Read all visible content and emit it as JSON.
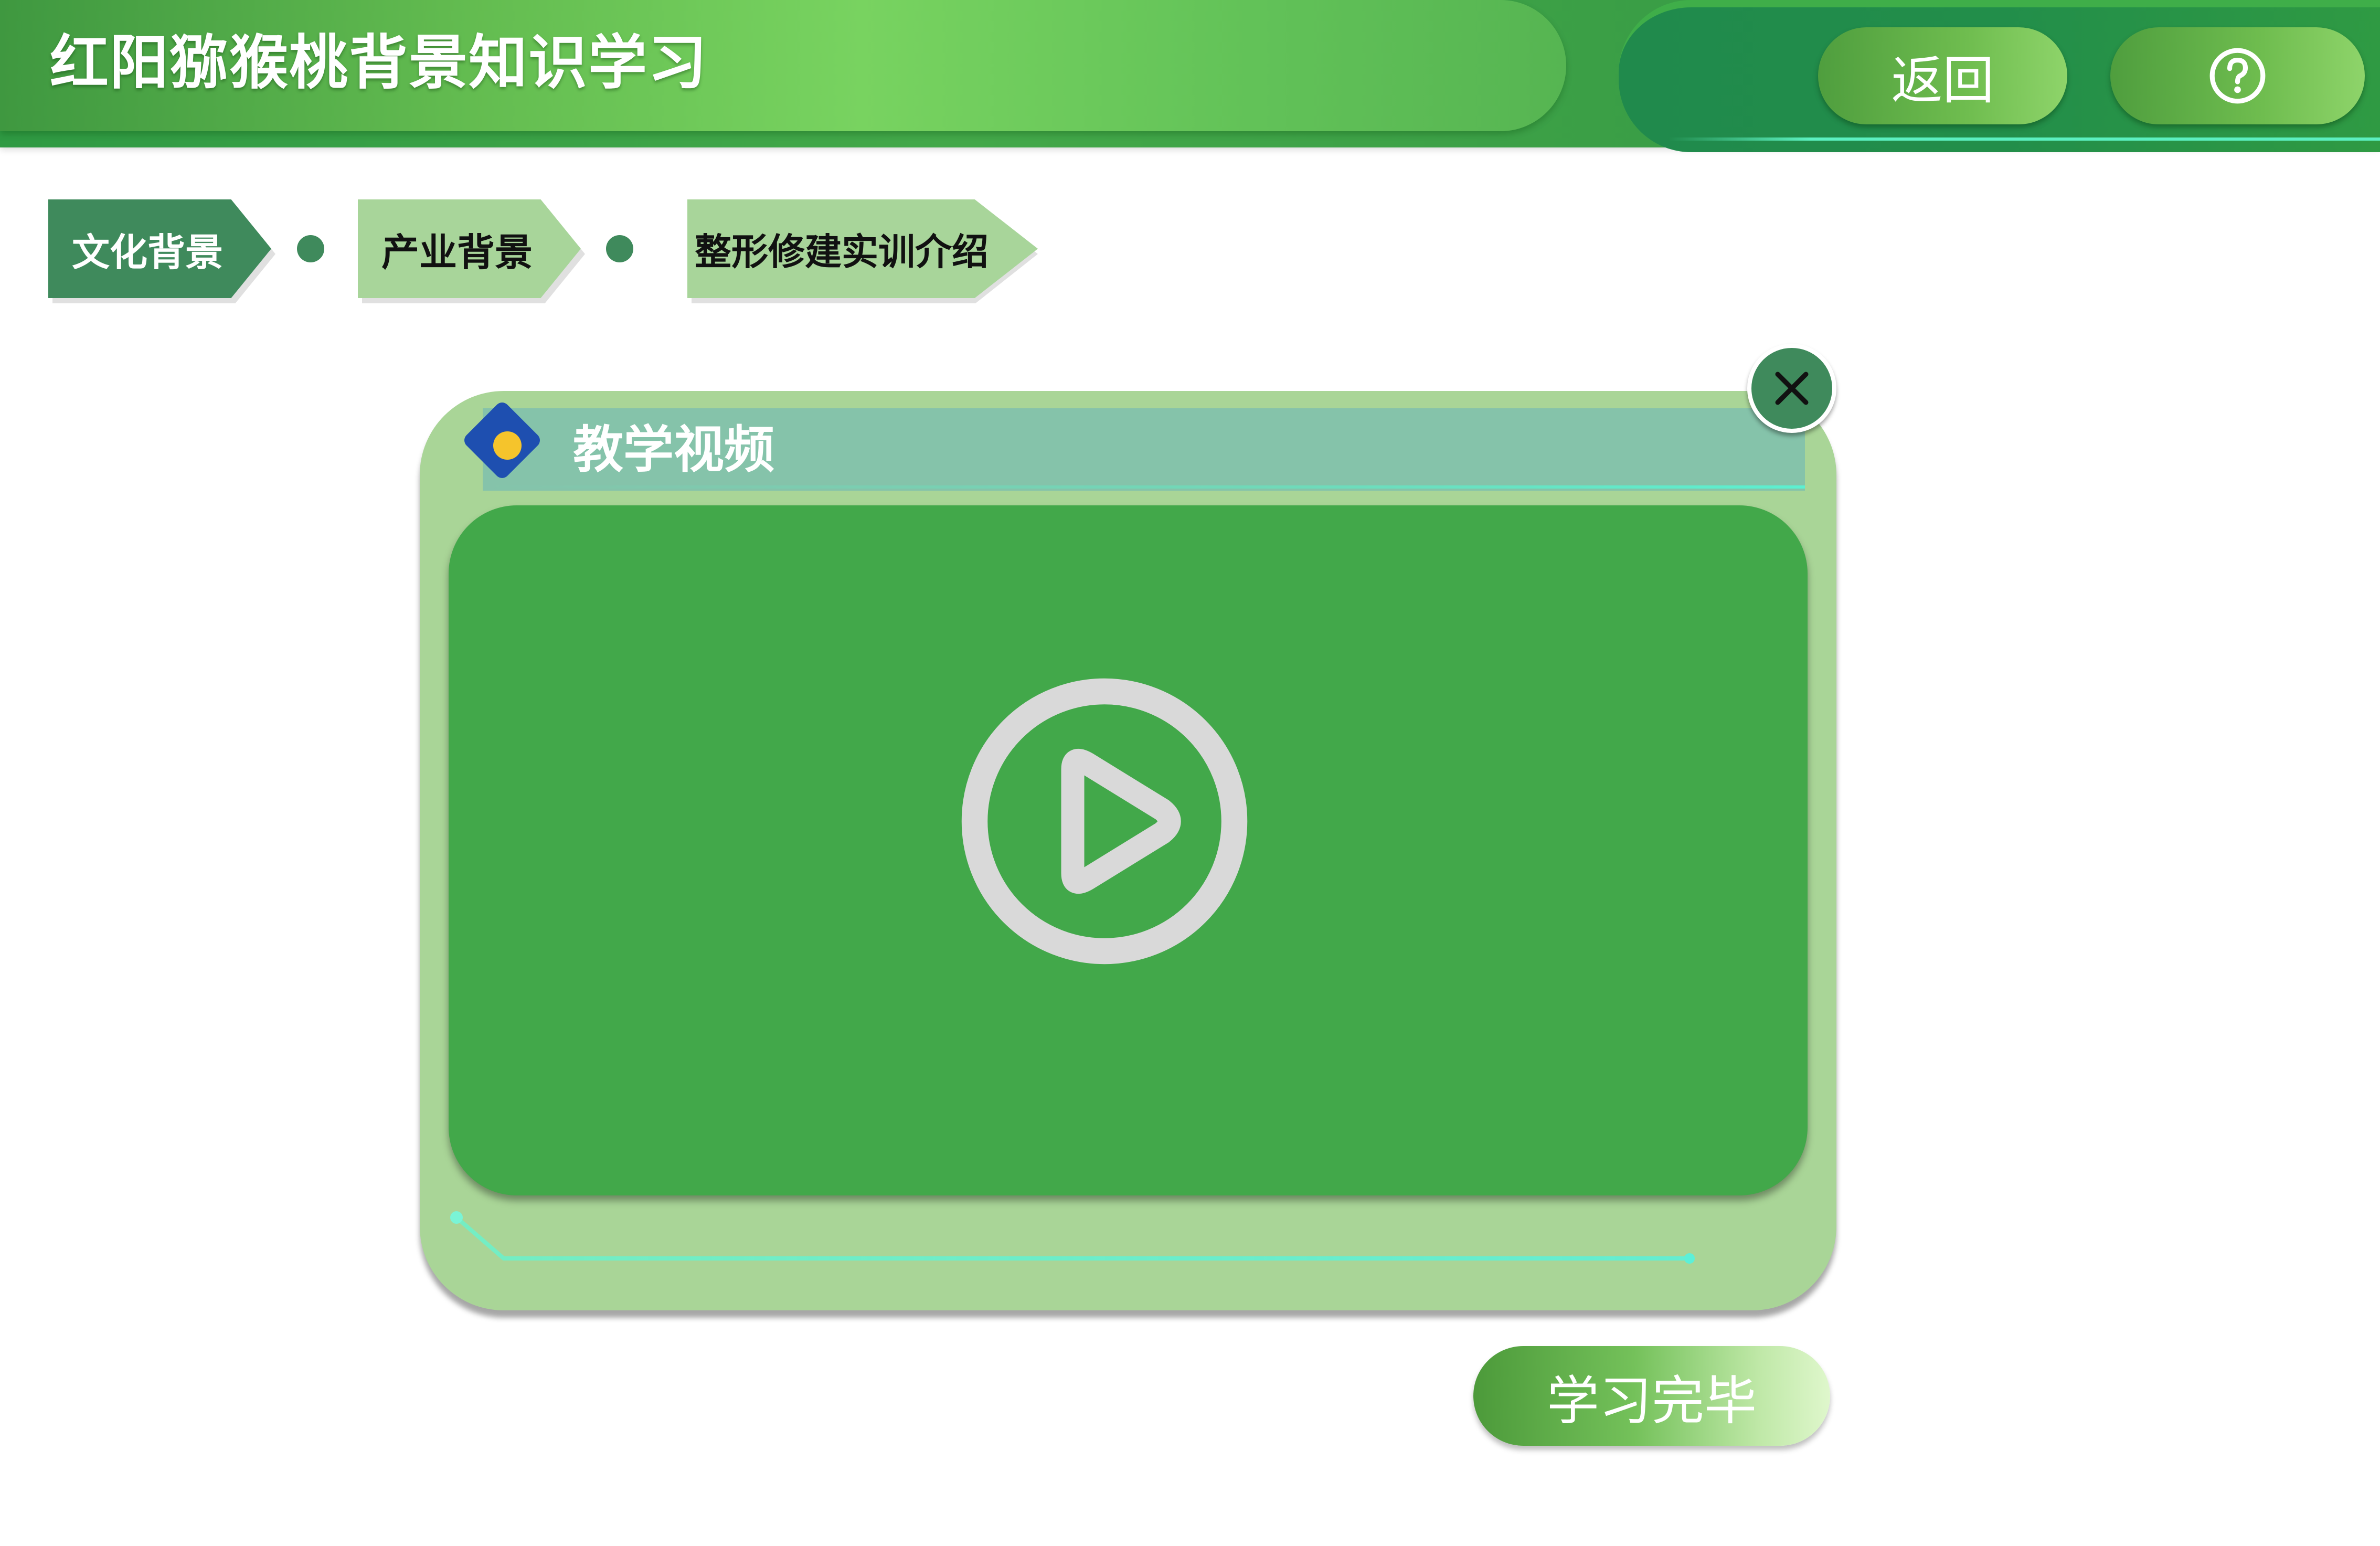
{
  "header": {
    "title": "红阳猕猴桃背景知识学习",
    "back_label": "返回",
    "help_icon": "question-circle-icon"
  },
  "steps": [
    {
      "label": "文化背景",
      "active": true
    },
    {
      "label": "产业背景",
      "active": false
    },
    {
      "label": "整形修建实训介绍",
      "active": false
    }
  ],
  "dialog": {
    "title": "教学视频",
    "title_icon": "diamond-dot-icon",
    "close_icon": "close-icon",
    "video": {
      "play_icon": "play-circle-icon"
    }
  },
  "footer": {
    "finish_label": "学习完毕"
  },
  "colors": {
    "primary_green": "#42a84a",
    "dark_green": "#3f8a5c",
    "light_green": "#a9d597",
    "teal_header": "#85c3aa",
    "accent_cyan": "#5cf0c0",
    "diamond_blue": "#1e4fb0",
    "dot_yellow": "#f5c42c"
  }
}
